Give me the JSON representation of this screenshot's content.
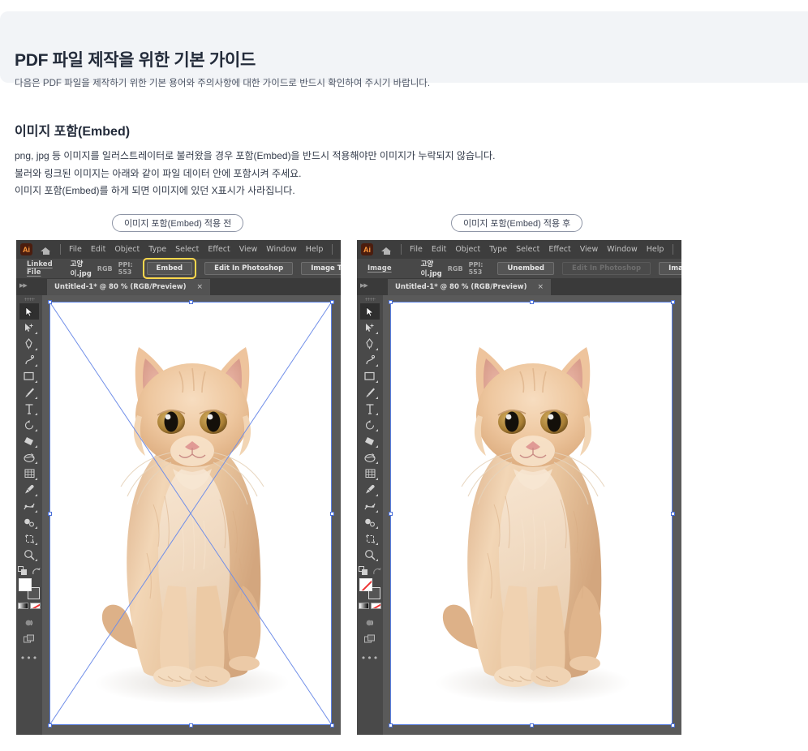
{
  "header": {
    "title": "PDF 파일 제작을 위한 기본 가이드",
    "subtitle": "다음은 PDF 파일을 제작하기 위한 기본 용어와 주의사항에 대한 가이드로 반드시 확인하여 주시기 바랍니다."
  },
  "section": {
    "title": "이미지 포함(Embed)",
    "lines": [
      "png, jpg 등 이미지를 일러스트레이터로 불러왔을 경우 포함(Embed)을 반드시 적용해야만 이미지가 누락되지 않습니다.",
      "불러와 링크된 이미지는 아래와 같이 파일 데이터 안에 포함시켜 주세요.",
      "이미지 포함(Embed)를 하게 되면 이미지에 있던 X표시가 사라집니다."
    ]
  },
  "captions": {
    "before": "이미지 포함(Embed) 적용 전",
    "after": "이미지 포함(Embed) 적용 후"
  },
  "colors": {
    "page_bg": "#ffffff",
    "card_bg": "#f2f4f7",
    "title": "#232b3a",
    "body": "#333b4a",
    "pill_border": "#8e95a6",
    "ai_chrome": "#535353",
    "ai_menubar": "#3d3d3d",
    "ai_ctrlbar": "#484848",
    "ai_canvas": "#5a5a5a",
    "highlight_yellow": "#ffd84d",
    "selection_blue": "#5a7fe0",
    "ai_logo_bg": "#4b1d0e",
    "ai_logo_fg": "#ff9a3d"
  },
  "menu": {
    "logo_text": "Ai",
    "items": [
      "File",
      "Edit",
      "Object",
      "Type",
      "Select",
      "Effect",
      "View",
      "Window",
      "Help"
    ]
  },
  "window_before": {
    "control": {
      "kind_label": "Linked File",
      "file_name": "고양이.jpg",
      "color_mode": "RGB",
      "ppi": "PPI: 553",
      "embed_button": "Embed",
      "embed_highlighted": true,
      "edit_button": "Edit In Photoshop",
      "edit_disabled": false,
      "trace_button": "Image Trace",
      "caret": "⌄"
    },
    "tab": {
      "title": "Untitled-1* @ 80 % (RGB/Preview)",
      "close": "×"
    },
    "has_x_marks": true
  },
  "window_after": {
    "control": {
      "kind_label": "Image",
      "file_name": "고양이.jpg",
      "color_mode": "RGB",
      "ppi": "PPI: 553",
      "embed_button": "Unembed",
      "embed_highlighted": false,
      "edit_button": "Edit In Photoshop",
      "edit_disabled": true,
      "trace_button": "Image Trace",
      "caret": "⌄"
    },
    "tab": {
      "title": "Untitled-1* @ 80 % (RGB/Preview)",
      "close": "×"
    },
    "has_x_marks": false
  },
  "toolbox": {
    "tools": [
      "selection-tool",
      "direct-selection-tool",
      "pen-tool",
      "curvature-tool",
      "rectangle-tool",
      "paintbrush-tool",
      "type-tool",
      "rotate-tool",
      "shape-builder-tool",
      "gradient-mesh-tool",
      "perspective-grid-tool",
      "eyedropper-tool",
      "blend-tool",
      "symbol-sprayer-tool",
      "artboard-tool",
      "zoom-tool"
    ],
    "more_label": "•••"
  },
  "artwork": {
    "subject": "orange-tabby-kitten",
    "background": "#ffffff"
  }
}
